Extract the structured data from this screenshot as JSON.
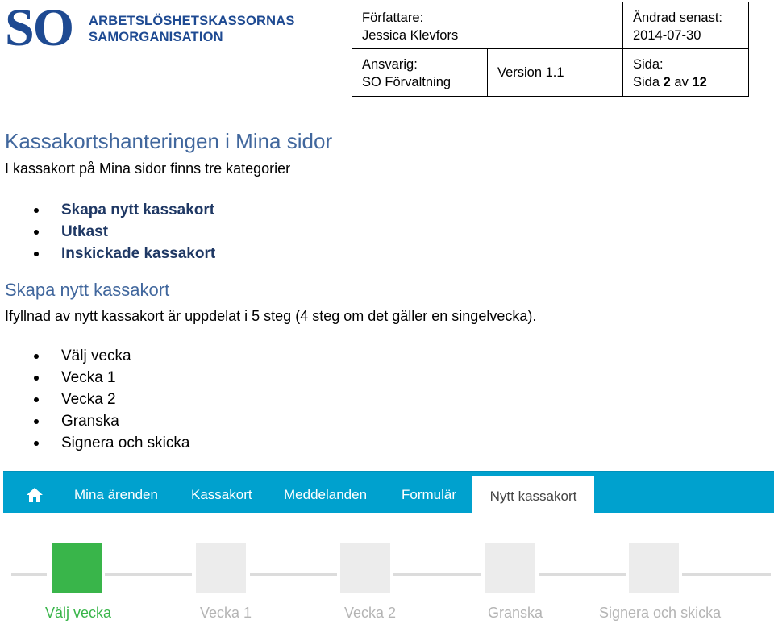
{
  "header": {
    "logo_so": "SO",
    "logo_line1": "ARBETSLÖSHETSKASSORNAS",
    "logo_line2": "SAMORGANISATION",
    "author_label": "Författare:",
    "author_value": "Jessica Klevfors",
    "changed_label": "Ändrad senast:",
    "changed_value": "2014-07-30",
    "responsible_label": "Ansvarig:",
    "responsible_value": "SO Förvaltning",
    "version": "Version 1.1",
    "page_label": "Sida:",
    "page_prefix": "Sida",
    "page_current": "2",
    "page_of": "av",
    "page_total": "12"
  },
  "content": {
    "title": "Kassakortshanteringen i Mina sidor",
    "intro": "I kassakort på Mina sidor finns tre kategorier",
    "categories": [
      "Skapa nytt kassakort",
      "Utkast",
      "Inskickade kassakort"
    ],
    "section_title": "Skapa nytt kassakort",
    "section_intro": "Ifyllnad av nytt kassakort är uppdelat i 5 steg (4 steg om det gäller en singelvecka).",
    "steps_list": [
      "Välj vecka",
      "Vecka 1",
      "Vecka 2",
      "Granska",
      "Signera och skicka"
    ]
  },
  "screenshot": {
    "nav_color": "#00a1ce",
    "nav_items": [
      "Mina ärenden",
      "Kassakort",
      "Meddelanden",
      "Formulär",
      "Nytt kassakort"
    ],
    "active_nav": "Nytt kassakort",
    "home_icon": "home-icon",
    "step_active_color": "#39b54a",
    "wizard_steps": [
      "Välj vecka",
      "Vecka 1",
      "Vecka 2",
      "Granska",
      "Signera och skicka"
    ],
    "current_step": 1
  }
}
